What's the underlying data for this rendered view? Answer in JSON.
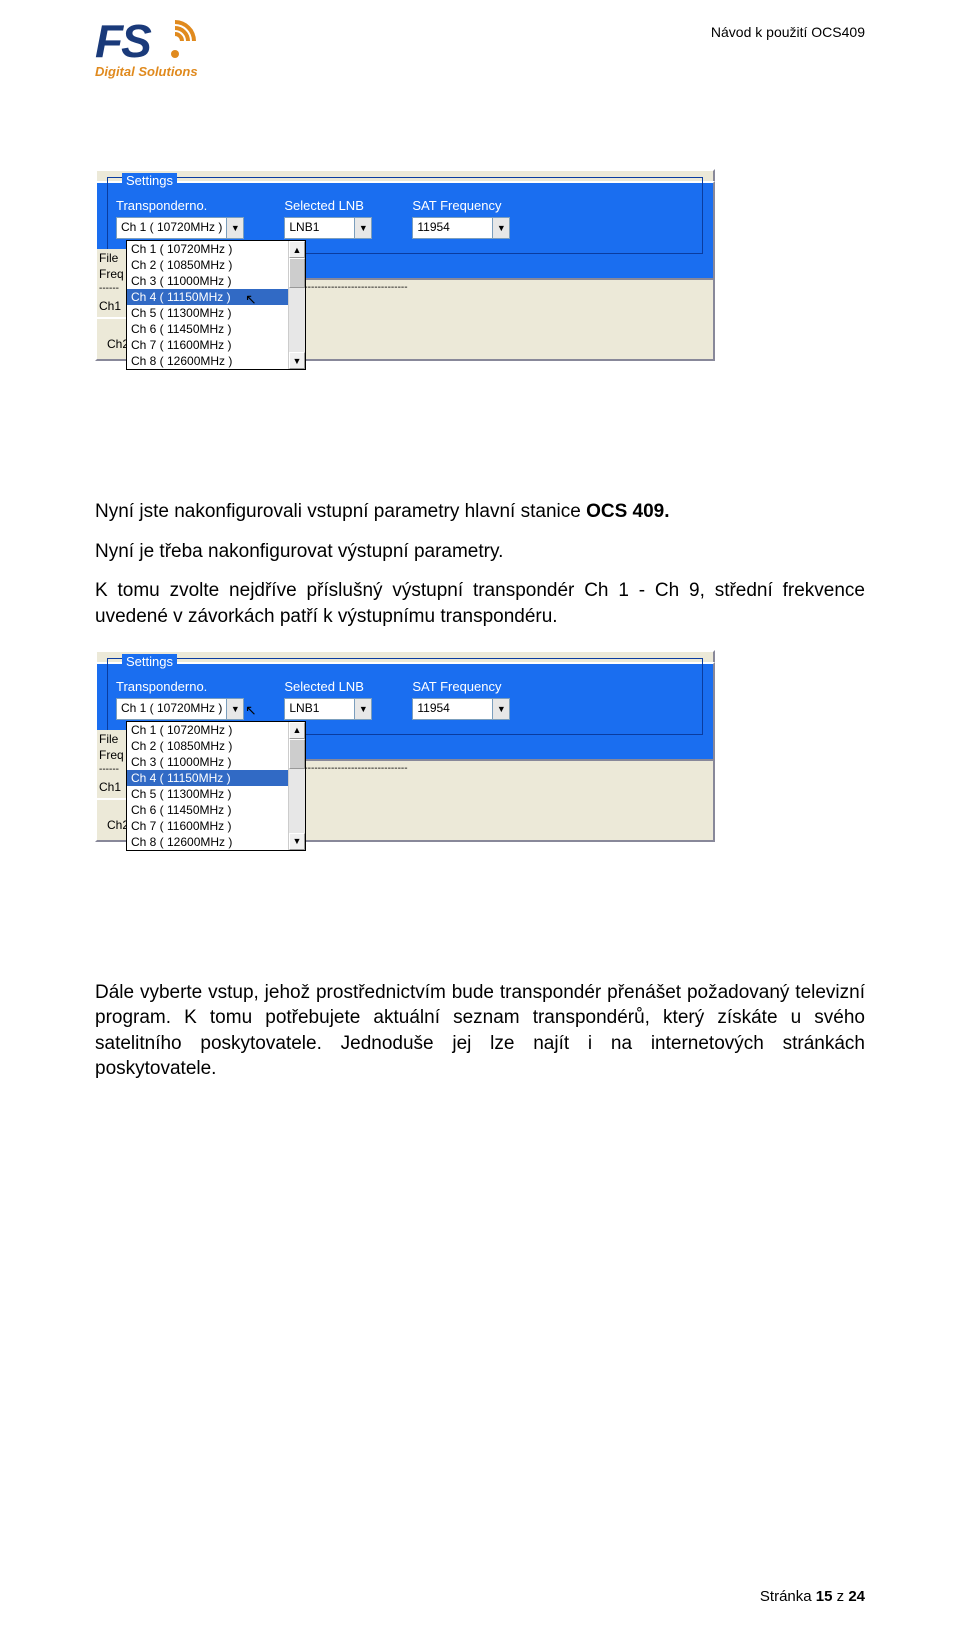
{
  "header": {
    "doc_code": "Návod k použití OCS409",
    "logo_text": "FS",
    "logo_sub": "Digital Solutions"
  },
  "settings_panel": {
    "legend": "Settings",
    "transponder_label": "Transponderno.",
    "transponder_value": "Ch 1 ( 10720MHz )",
    "lnb_label": "Selected LNB",
    "lnb_value": "LNB1",
    "sat_label": "SAT Frequency",
    "sat_value": "11954",
    "dropdown_items": [
      "Ch 1 ( 10720MHz )",
      "Ch 2 ( 10850MHz )",
      "Ch 3 ( 11000MHz )",
      "Ch 4 ( 11150MHz )",
      "Ch 5 ( 11300MHz )",
      "Ch 6 ( 11450MHz )",
      "Ch 7 ( 11600MHz )",
      "Ch 8 ( 12600MHz )"
    ],
    "dropdown_selected_index": 3,
    "left_labels": [
      "File",
      "Freq",
      "------",
      "Ch1"
    ],
    "ch2_label": "Ch2: --"
  },
  "paragraphs": {
    "p1a": "Nyní jste nakonfigurovali vstupní parametry hlavní stanice ",
    "p1b": "OCS 409.",
    "p2": "Nyní je třeba nakonfigurovat výstupní parametry.",
    "p3": "K tomu zvolte nejdříve příslušný výstupní transpondér Ch 1 - Ch 9, střední frekvence uvedené v závorkách patří k výstupnímu transpondéru.",
    "p4": "Dále vyberte vstup, jehož prostřednictvím bude transpondér přenášet požadovaný televizní program. K tomu potřebujete aktuální seznam transpondérů, který získáte u svého satelitního poskytovatele. Jednoduše jej lze najít i na internetových stránkách poskytovatele."
  },
  "footer": {
    "prefix": "Stránka ",
    "page": "15",
    "mid": " z ",
    "total": "24"
  }
}
